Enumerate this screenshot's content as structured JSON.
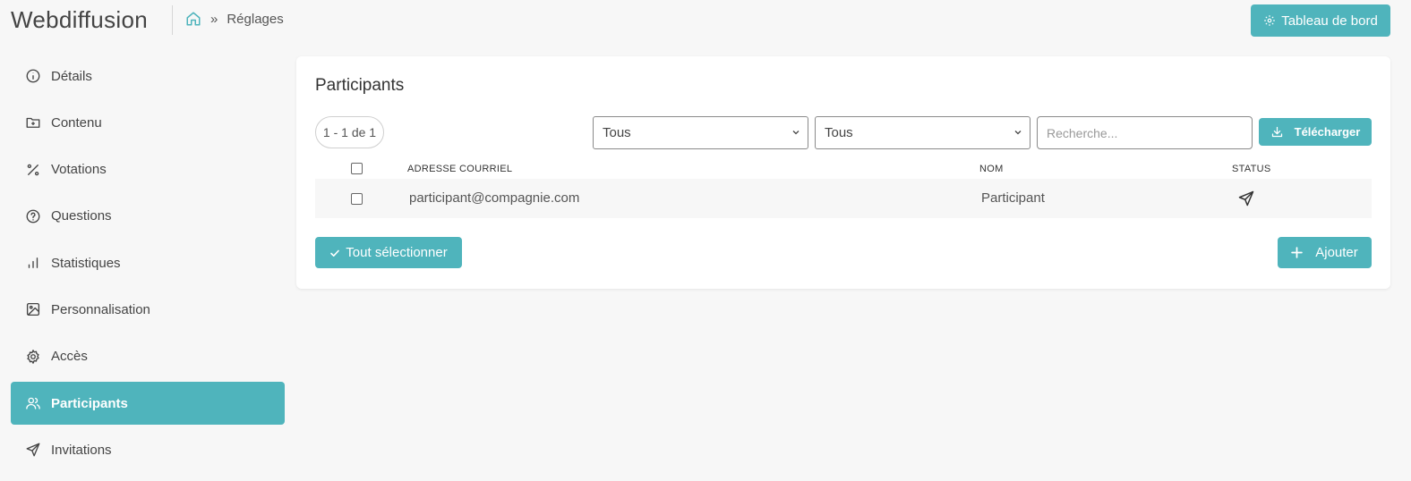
{
  "app": {
    "title": "Webdiffusion"
  },
  "breadcrumb": {
    "current": "Réglages",
    "separator": "»"
  },
  "header": {
    "dashboard_label": "Tableau de bord"
  },
  "sidebar": {
    "items": [
      {
        "label": "Détails",
        "icon": "info-icon"
      },
      {
        "label": "Contenu",
        "icon": "folder-plus-icon"
      },
      {
        "label": "Votations",
        "icon": "percent-icon"
      },
      {
        "label": "Questions",
        "icon": "help-circle-icon"
      },
      {
        "label": "Statistiques",
        "icon": "bar-chart-icon"
      },
      {
        "label": "Personnalisation",
        "icon": "image-icon"
      },
      {
        "label": "Accès",
        "icon": "gear-icon"
      },
      {
        "label": "Participants",
        "icon": "users-icon",
        "active": true
      },
      {
        "label": "Invitations",
        "icon": "send-icon"
      }
    ]
  },
  "main": {
    "title": "Participants",
    "count": "1 - 1 de 1",
    "filters": {
      "filter1": "Tous",
      "filter2": "Tous"
    },
    "search": {
      "placeholder": "Recherche..."
    },
    "download_label": "Télécharger",
    "table": {
      "headers": {
        "email": "ADRESSE COURRIEL",
        "name": "NOM",
        "status": "STATUS"
      },
      "rows": [
        {
          "email": "participant@compagnie.com",
          "name": "Participant",
          "status_icon": "send-icon"
        }
      ]
    },
    "select_all_label": "Tout sélectionner",
    "add_label": "Ajouter"
  },
  "colors": {
    "accent": "#4fb4bc"
  }
}
